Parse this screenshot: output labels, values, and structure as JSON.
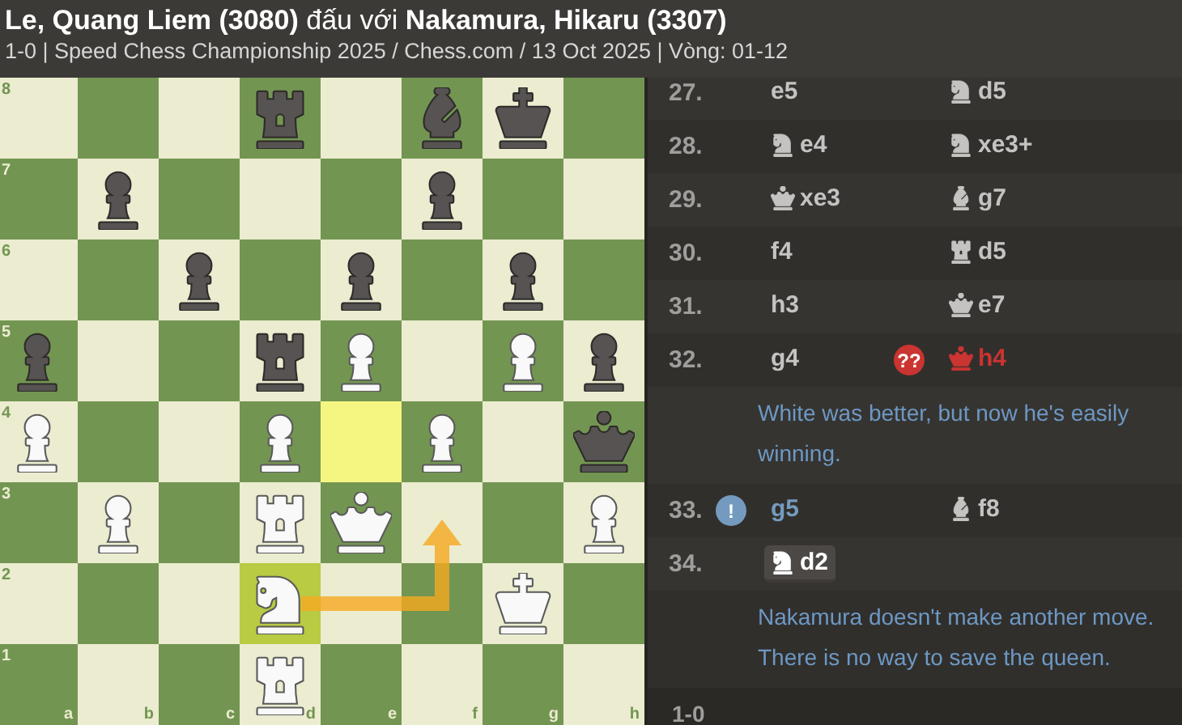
{
  "header": {
    "white_player": "Le, Quang Liem (3080)",
    "versus": "đấu với",
    "black_player": "Nakamura, Hikaru (3307)",
    "subtitle": "1-0 | Speed Chess Championship 2025 / Chess.com / 13 Oct 2025 | Vòng: 01-12"
  },
  "board": {
    "rank_labels": [
      "8",
      "7",
      "6",
      "5",
      "4",
      "3",
      "2",
      "1"
    ],
    "file_labels": [
      "a",
      "b",
      "c",
      "d",
      "e",
      "f",
      "g",
      "h"
    ],
    "rows": [
      [
        {
          "highlighted": false
        },
        {
          "highlighted": false
        },
        {
          "highlighted": false
        },
        {
          "highlighted": false,
          "kind": "rook",
          "black": true
        },
        {
          "highlighted": false
        },
        {
          "highlighted": false,
          "kind": "bishop",
          "black": true
        },
        {
          "highlighted": false,
          "kind": "king",
          "black": true
        },
        {
          "highlighted": false
        }
      ],
      [
        {
          "highlighted": false
        },
        {
          "highlighted": false,
          "kind": "pawn",
          "black": true
        },
        {
          "highlighted": false
        },
        {
          "highlighted": false
        },
        {
          "highlighted": false
        },
        {
          "highlighted": false,
          "kind": "pawn",
          "black": true
        },
        {
          "highlighted": false
        },
        {
          "highlighted": false
        }
      ],
      [
        {
          "highlighted": false
        },
        {
          "highlighted": false
        },
        {
          "highlighted": false,
          "kind": "pawn",
          "black": true
        },
        {
          "highlighted": false
        },
        {
          "highlighted": false,
          "kind": "pawn",
          "black": true
        },
        {
          "highlighted": false
        },
        {
          "highlighted": false,
          "kind": "pawn",
          "black": true
        },
        {
          "highlighted": false
        }
      ],
      [
        {
          "highlighted": false,
          "kind": "pawn",
          "black": true
        },
        {
          "highlighted": false
        },
        {
          "highlighted": false
        },
        {
          "highlighted": false,
          "kind": "rook",
          "black": true
        },
        {
          "highlighted": false,
          "kind": "pawn",
          "black": false
        },
        {
          "highlighted": false
        },
        {
          "highlighted": false,
          "kind": "pawn",
          "black": false
        },
        {
          "highlighted": false,
          "kind": "pawn",
          "black": true
        }
      ],
      [
        {
          "highlighted": false,
          "kind": "pawn",
          "black": false
        },
        {
          "highlighted": false
        },
        {
          "highlighted": false
        },
        {
          "highlighted": false,
          "kind": "pawn",
          "black": false
        },
        {
          "highlighted": true
        },
        {
          "highlighted": false,
          "kind": "pawn",
          "black": false
        },
        {
          "highlighted": false
        },
        {
          "highlighted": false,
          "kind": "queen",
          "black": true
        }
      ],
      [
        {
          "highlighted": false
        },
        {
          "highlighted": false,
          "kind": "pawn",
          "black": false
        },
        {
          "highlighted": false
        },
        {
          "highlighted": false,
          "kind": "rook",
          "black": false
        },
        {
          "highlighted": false,
          "kind": "queen",
          "black": false
        },
        {
          "highlighted": false,
          "arrow_end": true
        },
        {
          "highlighted": false
        },
        {
          "highlighted": false,
          "kind": "pawn",
          "black": false
        }
      ],
      [
        {
          "highlighted": false
        },
        {
          "highlighted": false
        },
        {
          "highlighted": false
        },
        {
          "highlighted": true,
          "kind": "knight",
          "black": false,
          "arrow_start": true
        },
        {
          "highlighted": false
        },
        {
          "highlighted": false
        },
        {
          "highlighted": false,
          "kind": "king",
          "black": false
        },
        {
          "highlighted": false
        }
      ],
      [
        {
          "highlighted": false
        },
        {
          "highlighted": false
        },
        {
          "highlighted": false
        },
        {
          "highlighted": false,
          "kind": "rook",
          "black": false
        },
        {
          "highlighted": false
        },
        {
          "highlighted": false
        },
        {
          "highlighted": false
        },
        {
          "highlighted": false
        }
      ]
    ]
  },
  "moves": [
    {
      "number": "27.",
      "white": {
        "san": "e5",
        "selected": false
      },
      "black": {
        "kind": "knight",
        "san": "d5",
        "selected": false
      }
    },
    {
      "number": "28.",
      "white": {
        "kind": "knight",
        "san": "e4",
        "selected": false
      },
      "black": {
        "kind": "knight",
        "san": "xe3+",
        "selected": false
      }
    },
    {
      "number": "29.",
      "white": {
        "kind": "queen",
        "san": "xe3",
        "selected": false
      },
      "black": {
        "kind": "bishop",
        "san": "g7",
        "selected": false
      }
    },
    {
      "number": "30.",
      "white": {
        "san": "f4",
        "selected": false
      },
      "black": {
        "kind": "rook",
        "san": "d5",
        "selected": false
      }
    },
    {
      "number": "31.",
      "white": {
        "san": "h3",
        "selected": false
      },
      "black": {
        "kind": "queen",
        "san": "e7",
        "selected": false
      }
    },
    {
      "number": "32.",
      "white": {
        "san": "g4",
        "selected": false
      },
      "black": {
        "kind": "queen",
        "san": "h4",
        "selected": false,
        "annotation": {
          "kind": "blunder",
          "symbol": "??"
        }
      },
      "comment": [
        "White was better, but now he's easily",
        "winning."
      ]
    },
    {
      "number": "33.",
      "white": {
        "san": "g5",
        "selected": false,
        "annotation": {
          "kind": "good",
          "symbol": "!"
        }
      },
      "black": {
        "kind": "bishop",
        "san": "f8",
        "selected": false
      }
    },
    {
      "number": "34.",
      "white": {
        "kind": "knight",
        "san": "d2",
        "selected": true
      },
      "comment": [
        "Nakamura doesn't make another move.",
        "There is no way to save the queen."
      ]
    }
  ],
  "result": "1-0"
}
